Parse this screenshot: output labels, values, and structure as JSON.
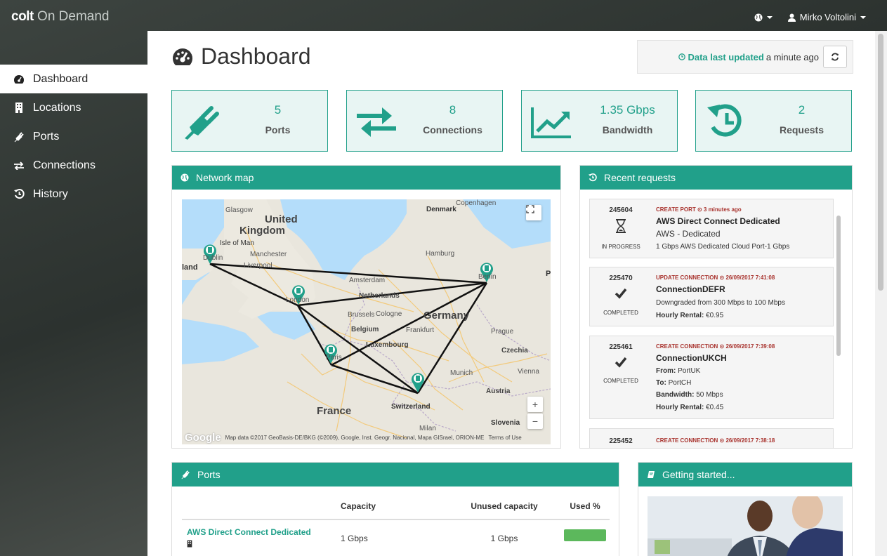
{
  "topbar": {
    "brand_bold": "colt",
    "brand_rest": " On Demand",
    "user_name": "Mirko Voltolini"
  },
  "sidebar": {
    "items": [
      {
        "label": "Dashboard",
        "icon": "tachometer-icon"
      },
      {
        "label": "Locations",
        "icon": "building-icon"
      },
      {
        "label": "Ports",
        "icon": "plug-icon"
      },
      {
        "label": "Connections",
        "icon": "exchange-icon"
      },
      {
        "label": "History",
        "icon": "history-icon"
      }
    ]
  },
  "header": {
    "title": "Dashboard",
    "updated_bold": "Data last updated",
    "updated_rest": "a minute ago"
  },
  "stats": [
    {
      "value": "5",
      "label": "Ports",
      "icon": "plug-icon"
    },
    {
      "value": "8",
      "label": "Connections",
      "icon": "exchange-icon"
    },
    {
      "value": "1.35 Gbps",
      "label": "Bandwidth",
      "icon": "line-chart-icon"
    },
    {
      "value": "2",
      "label": "Requests",
      "icon": "history-icon"
    }
  ],
  "network_map": {
    "title": "Network map",
    "labels": {
      "copenhagen": "Copenhagen",
      "glasgow": "Glasgow",
      "denmark": "Denmark",
      "uk1": "United",
      "uk2": "Kingdom",
      "isle_of_man": "Isle of Man",
      "manchester": "Manchester",
      "dublin": "Dublin",
      "liverpool": "Liverpool",
      "hamburg": "Hamburg",
      "land": "land",
      "berlin": "Berlin",
      "amsterdam": "Amsterdam",
      "netherlands": "Netherlands",
      "london": "London",
      "brussels": "Brussels",
      "cologne": "Cologne",
      "germany": "Germany",
      "belgium": "Belgium",
      "frankfurt": "Frankfurt",
      "prague": "Prague",
      "luxembourg": "Luxembourg",
      "czechia": "Czechia",
      "paris": "Paris",
      "munich": "Munich",
      "vienna": "Vienna",
      "austria": "Austria",
      "france": "France",
      "switzerland": "Switzerland",
      "slovenia": "Slovenia",
      "milan": "Milan",
      "p": "P"
    },
    "footer": "Map data ©2017 GeoBasis-DE/BKG (©2009), Google, Inst. Geogr. Nacional, Mapa GISrael, ORION-ME",
    "terms": "Terms of Use",
    "google": "Google"
  },
  "recent_requests": {
    "title": "Recent requests",
    "items": [
      {
        "id": "245604",
        "type": "CREATE PORT ⊙ 3 minutes ago",
        "title": "AWS Direct Connect Dedicated",
        "line1": "AWS - Dedicated",
        "line2": "1 Gbps AWS Dedicated Cloud Port-1 Gbps",
        "status": "IN PROGRESS"
      },
      {
        "id": "225470",
        "type": "UPDATE CONNECTION ⊙ 26/09/2017 7:41:08",
        "title": "ConnectionDEFR",
        "line1": "Downgraded from 300 Mbps to 100 Mbps",
        "line2_label": "Hourly Rental:",
        "line2_value": " €0.95",
        "status": "COMPLETED"
      },
      {
        "id": "225461",
        "type": "CREATE CONNECTION ⊙ 26/09/2017 7:39:08",
        "title": "ConnectionUKCH",
        "from_label": "From:",
        "from_value": " PortUK",
        "to_label": "To:",
        "to_value": " PortCH",
        "bw_label": "Bandwidth:",
        "bw_value": " 50 Mbps",
        "rent_label": "Hourly Rental:",
        "rent_value": " €0.45",
        "status": "COMPLETED"
      },
      {
        "id": "225452",
        "type": "CREATE CONNECTION ⊙ 26/09/2017 7:38:18"
      }
    ]
  },
  "ports": {
    "title": "Ports",
    "columns": [
      "",
      "Capacity",
      "Unused capacity",
      "Used %"
    ],
    "rows": [
      {
        "name": "AWS Direct Connect Dedicated",
        "capacity": "1 Gbps",
        "unused": "1 Gbps",
        "used_fraction": 1.0
      }
    ]
  },
  "getting_started": {
    "title": "Getting started..."
  },
  "colors": {
    "accent": "#21a08a",
    "tile_bg": "#e8f5f3",
    "request_type": "#a8322d",
    "used_bar": "#5cb85c"
  }
}
